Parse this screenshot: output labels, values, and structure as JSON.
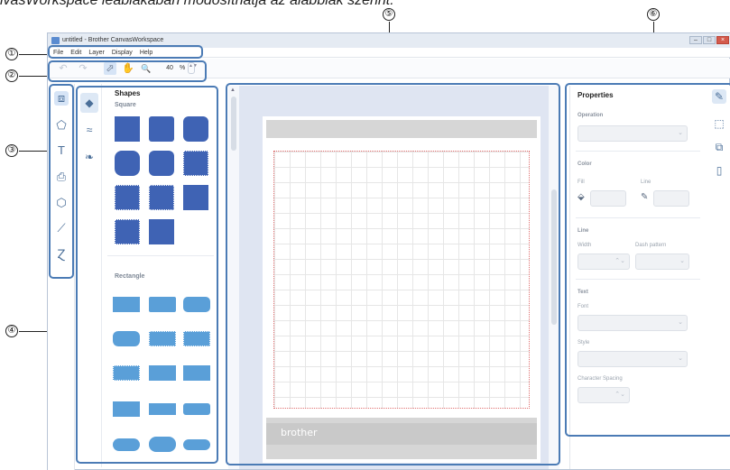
{
  "caption": "ivasWorkspace ieablakában módosíthatja az alábbiak szerint.",
  "callouts": [
    "①",
    "②",
    "③",
    "④",
    "⑤",
    "⑥"
  ],
  "window": {
    "title": "untitled - Brother CanvasWorkspace",
    "controls": [
      "–",
      "□",
      "×"
    ]
  },
  "menu": [
    "File",
    "Edit",
    "Layer",
    "Display",
    "Help"
  ],
  "toolbar": {
    "undo": "↶",
    "redo": "↷",
    "select": "⬀",
    "hand": "✋",
    "zoom_icon": "🔍",
    "zoom_value": "40",
    "zoom_unit": "%",
    "spin": "▲▼"
  },
  "left_tools": [
    {
      "icon": "select-icon",
      "glyph": "⧈"
    },
    {
      "icon": "shapes-icon",
      "glyph": "⬠"
    },
    {
      "icon": "text-icon",
      "glyph": "T"
    },
    {
      "icon": "scan-icon",
      "glyph": "⎙"
    },
    {
      "icon": "outline-icon",
      "glyph": "⬡"
    },
    {
      "icon": "line-icon",
      "glyph": "⟋"
    },
    {
      "icon": "freehand-icon",
      "glyph": "Ɀ"
    }
  ],
  "shapes_panel": {
    "title": "Shapes",
    "categories": [
      {
        "icon": "basic-shapes-icon",
        "glyph": "◆"
      },
      {
        "icon": "borders-icon",
        "glyph": "≈"
      },
      {
        "icon": "patterns-icon",
        "glyph": "❧"
      }
    ],
    "sections": [
      "Square",
      "Rectangle"
    ]
  },
  "mat": {
    "brand": "brother"
  },
  "properties": {
    "title": "Properties",
    "operation_label": "Operation",
    "color_label": "Color",
    "fill_label": "Fill",
    "line_sub_label": "Line",
    "line_label": "Line",
    "width_label": "Width",
    "dash_label": "Dash pattern",
    "text_label": "Text",
    "font_label": "Font",
    "style_label": "Style",
    "spacing_label": "Character Spacing",
    "chevron": "⌄",
    "spin": "⌃⌄"
  },
  "right_tools": [
    {
      "icon": "properties-icon",
      "glyph": "✎"
    },
    {
      "icon": "transform-icon",
      "glyph": "⬚"
    },
    {
      "icon": "layers-icon",
      "glyph": "⧉"
    },
    {
      "icon": "page-icon",
      "glyph": "▯"
    }
  ],
  "colors": {
    "highlight": "#4b7bb5",
    "shape_dark": "#3f63b4",
    "shape_light": "#5a9fd8"
  }
}
